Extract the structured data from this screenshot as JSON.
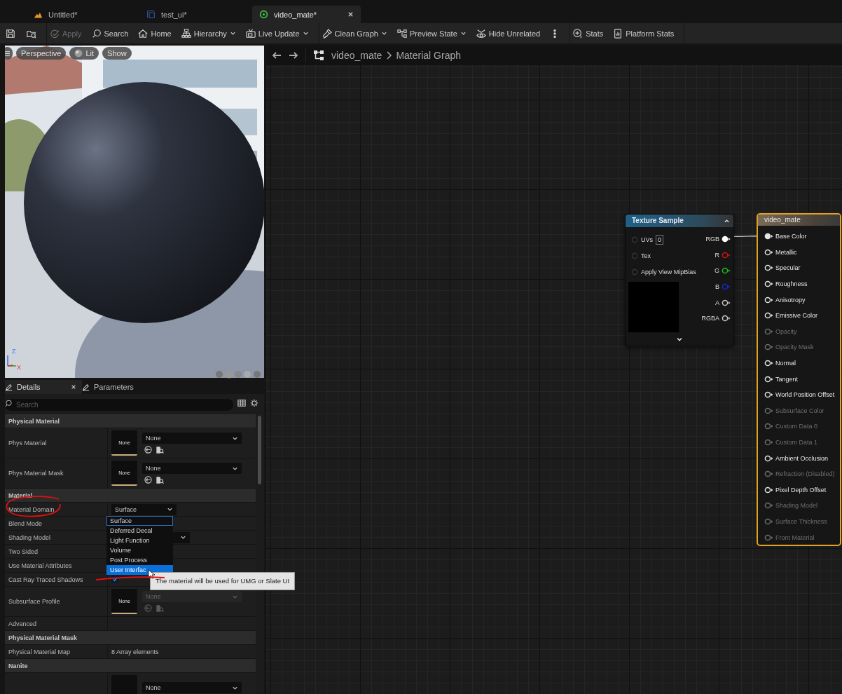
{
  "tabs": [
    {
      "label": "Untitled*",
      "kind": "level",
      "selected": false
    },
    {
      "label": "test_ui*",
      "kind": "widget",
      "selected": false
    },
    {
      "label": "video_mate*",
      "kind": "material",
      "selected": true
    }
  ],
  "toolbar": [
    {
      "items": [
        {
          "kind": "save",
          "disabled": false,
          "dropdown": false
        },
        {
          "kind": "browse",
          "disabled": false,
          "dropdown": false
        }
      ]
    },
    {
      "items": [
        {
          "kind": "apply",
          "label": "Apply",
          "disabled": true,
          "dropdown": false
        },
        {
          "kind": "search",
          "label": "Search",
          "disabled": false,
          "dropdown": false
        },
        {
          "kind": "home",
          "label": "Home",
          "disabled": false,
          "dropdown": false
        },
        {
          "kind": "hierarchy",
          "label": "Hierarchy",
          "disabled": false,
          "dropdown": true
        },
        {
          "kind": "live",
          "label": "Live Update",
          "disabled": false,
          "dropdown": true
        }
      ]
    },
    {
      "items": [
        {
          "kind": "clean",
          "label": "Clean Graph",
          "disabled": false,
          "dropdown": true
        },
        {
          "kind": "preview",
          "label": "Preview State",
          "disabled": false,
          "dropdown": true
        },
        {
          "kind": "hide",
          "label": "Hide Unrelated",
          "disabled": false,
          "dropdown": false
        },
        {
          "kind": "more",
          "disabled": false,
          "dropdown": false
        }
      ]
    },
    {
      "items": [
        {
          "kind": "stats",
          "label": "Stats",
          "disabled": false,
          "dropdown": false
        },
        {
          "kind": "platform",
          "label": "Platform Stats",
          "disabled": false,
          "dropdown": false
        }
      ]
    }
  ],
  "viewport": {
    "buttons": [
      {
        "label": "Perspective",
        "kind": "plain"
      },
      {
        "label": "Lit",
        "kind": "lit"
      },
      {
        "label": "Show",
        "kind": "plain"
      }
    ],
    "axes": [
      "Z",
      "X"
    ]
  },
  "details": {
    "tabs": [
      {
        "label": "Details",
        "selected": true
      },
      {
        "label": "Parameters",
        "selected": false
      }
    ],
    "search": {
      "placeholder": "Search"
    },
    "rows": [
      {
        "kind": "section",
        "label": "Physical Material"
      },
      {
        "kind": "asset",
        "label": "Phys Material",
        "thumb": "None",
        "value": "None",
        "disabled": false
      },
      {
        "kind": "asset",
        "label": "Phys Material Mask",
        "thumb": "None",
        "value": "None",
        "disabled": false
      },
      {
        "kind": "section",
        "label": "Material"
      },
      {
        "kind": "combo",
        "label": "Material Domain",
        "value": "Surface"
      },
      {
        "kind": "plain",
        "label": "Blend Mode"
      },
      {
        "kind": "combo",
        "label": "Shading Model"
      },
      {
        "kind": "plain",
        "label": "Two Sided"
      },
      {
        "kind": "plain",
        "label": "Use Material Attributes"
      },
      {
        "kind": "checkbox",
        "label": "Cast Ray Traced Shadows",
        "checked": true
      },
      {
        "kind": "asset",
        "label": "Subsurface Profile",
        "thumb": "None",
        "value": "None",
        "disabled": true
      },
      {
        "kind": "plain",
        "label": "Advanced"
      },
      {
        "kind": "section",
        "label": "Physical Material Mask"
      },
      {
        "kind": "text",
        "label": "Physical Material Map",
        "value": "8 Array elements"
      },
      {
        "kind": "section",
        "label": "Nanite"
      },
      {
        "kind": "asset",
        "value": "None",
        "disabled": false
      }
    ],
    "domain_menu": {
      "options": [
        {
          "label": "Surface",
          "current": true,
          "selected": false
        },
        {
          "label": "Deferred Decal",
          "current": false,
          "selected": false
        },
        {
          "label": "Light Function",
          "current": false,
          "selected": false
        },
        {
          "label": "Volume",
          "current": false,
          "selected": false
        },
        {
          "label": "Post Process",
          "current": false,
          "selected": false
        },
        {
          "label": "User Interfac",
          "current": false,
          "selected": true
        }
      ],
      "tooltip": "The material will be used for UMG or Slate UI"
    }
  },
  "graph": {
    "breadcrumb": {
      "asset": "video_mate",
      "graph": "Material Graph"
    },
    "texture_node": {
      "title": "Texture Sample",
      "inputs": [
        {
          "label": "UVs",
          "value": "0"
        },
        {
          "label": "Tex"
        },
        {
          "label": "Apply View MipBias"
        }
      ],
      "outputs": [
        {
          "label": "RGB",
          "color": "#ffffff",
          "connected": true
        },
        {
          "label": "R",
          "color": "#d01414",
          "connected": false
        },
        {
          "label": "G",
          "color": "#18c018",
          "connected": false
        },
        {
          "label": "B",
          "color": "#1828d0",
          "connected": false
        },
        {
          "label": "A",
          "color": "#c8c8c8",
          "connected": false
        },
        {
          "label": "RGBA",
          "color": "#c8c8c8",
          "connected": false
        }
      ]
    },
    "material_node": {
      "title": "video_mate",
      "inputs": [
        {
          "label": "Base Color",
          "enabled": true,
          "connected": true
        },
        {
          "label": "Metallic",
          "enabled": true,
          "connected": false
        },
        {
          "label": "Specular",
          "enabled": true,
          "connected": false
        },
        {
          "label": "Roughness",
          "enabled": true,
          "connected": false
        },
        {
          "label": "Anisotropy",
          "enabled": true,
          "connected": false
        },
        {
          "label": "Emissive Color",
          "enabled": true,
          "connected": false
        },
        {
          "label": "Opacity",
          "enabled": false,
          "connected": false
        },
        {
          "label": "Opacity Mask",
          "enabled": false,
          "connected": false
        },
        {
          "label": "Normal",
          "enabled": true,
          "connected": false
        },
        {
          "label": "Tangent",
          "enabled": true,
          "connected": false
        },
        {
          "label": "World Position Offset",
          "enabled": true,
          "connected": false
        },
        {
          "label": "Subsurface Color",
          "enabled": false,
          "connected": false
        },
        {
          "label": "Custom Data 0",
          "enabled": false,
          "connected": false
        },
        {
          "label": "Custom Data 1",
          "enabled": false,
          "connected": false
        },
        {
          "label": "Ambient Occlusion",
          "enabled": true,
          "connected": false
        },
        {
          "label": "Refraction (Disabled)",
          "enabled": false,
          "connected": false
        },
        {
          "label": "Pixel Depth Offset",
          "enabled": true,
          "connected": false
        },
        {
          "label": "Shading Model",
          "enabled": false,
          "connected": false
        },
        {
          "label": "Surface Thickness",
          "enabled": false,
          "connected": false
        },
        {
          "label": "Front Material",
          "enabled": false,
          "connected": false
        }
      ]
    }
  }
}
